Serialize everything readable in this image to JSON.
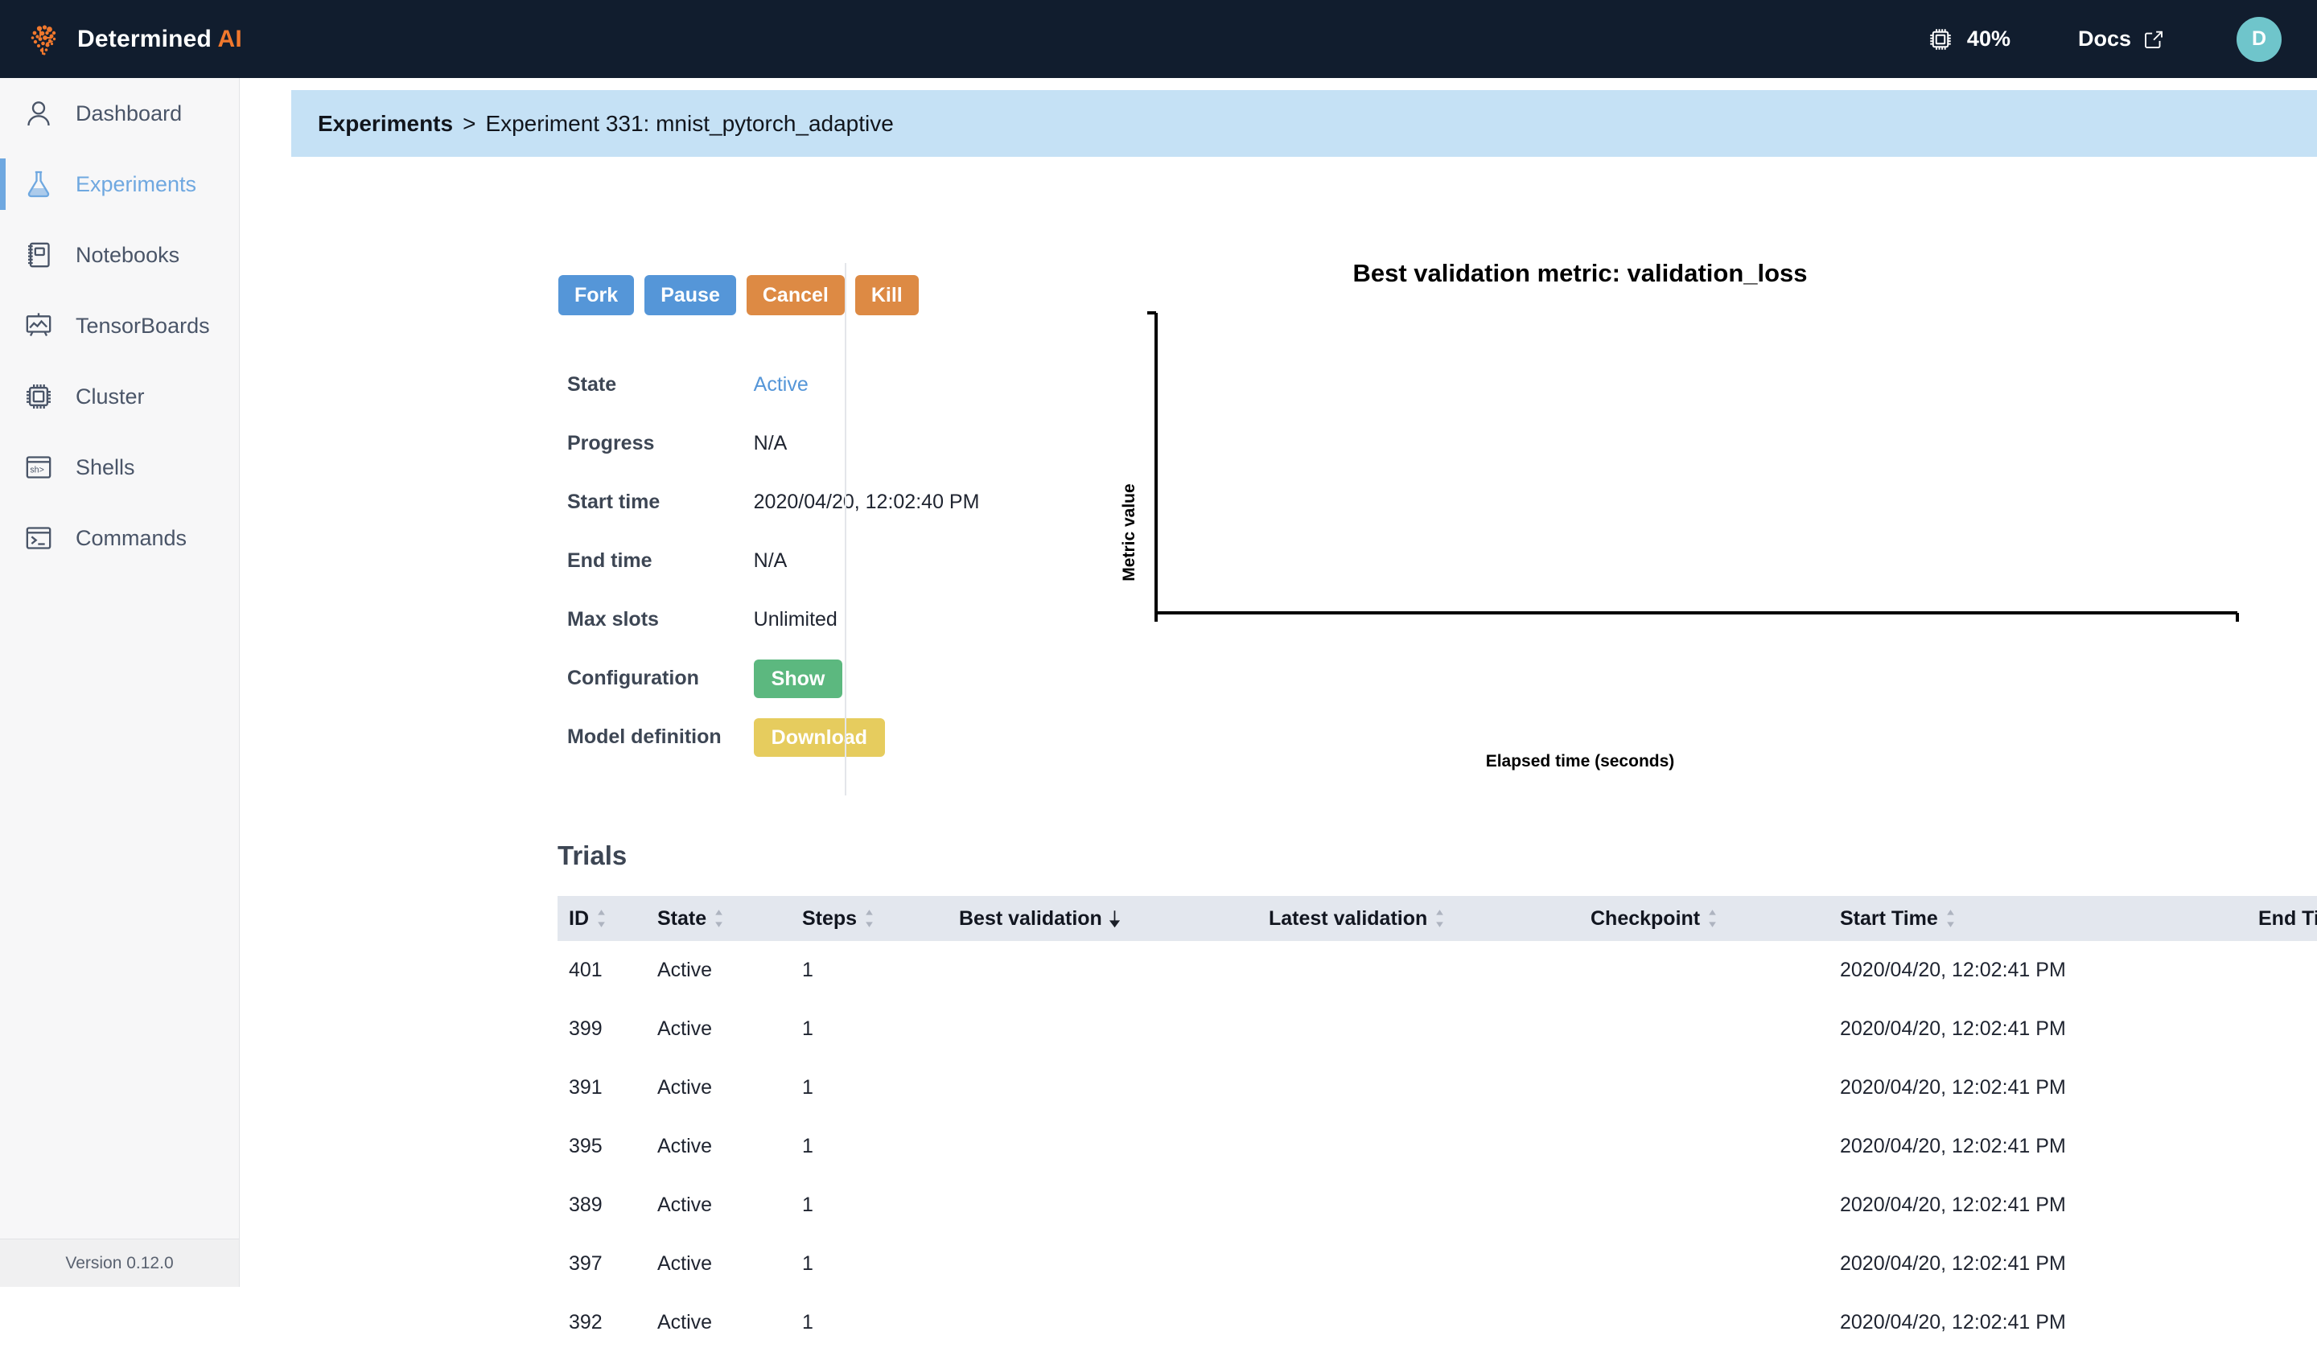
{
  "topbar": {
    "brand_name": "Determined",
    "brand_suffix": "AI",
    "brand_logo_icon": "brain-logo-icon",
    "cluster_icon": "cpu-chip-icon",
    "cluster_utilization": "40%",
    "docs_label": "Docs",
    "docs_icon": "external-link-icon",
    "avatar_initial": "D"
  },
  "sidebar": {
    "items": [
      {
        "label": "Dashboard",
        "icon": "user-icon",
        "active": false
      },
      {
        "label": "Experiments",
        "icon": "flask-icon",
        "active": true
      },
      {
        "label": "Notebooks",
        "icon": "notebook-icon",
        "active": false
      },
      {
        "label": "TensorBoards",
        "icon": "chart-board-icon",
        "active": false
      },
      {
        "label": "Cluster",
        "icon": "cpu-chip-icon",
        "active": false
      },
      {
        "label": "Shells",
        "icon": "shell-prompt-icon",
        "active": false
      },
      {
        "label": "Commands",
        "icon": "terminal-icon",
        "active": false
      }
    ],
    "version": "Version 0.12.0"
  },
  "breadcrumb": {
    "root": "Experiments",
    "separator": ">",
    "current": "Experiment 331: mnist_pytorch_adaptive"
  },
  "actions": [
    {
      "label": "Fork",
      "style": "blue"
    },
    {
      "label": "Pause",
      "style": "blue"
    },
    {
      "label": "Cancel",
      "style": "orange"
    },
    {
      "label": "Kill",
      "style": "orange"
    }
  ],
  "details": {
    "state_label": "State",
    "state_value": "Active",
    "progress_label": "Progress",
    "progress_value": "N/A",
    "start_time_label": "Start time",
    "start_time_value": "2020/04/20, 12:02:40 PM",
    "end_time_label": "End time",
    "end_time_value": "N/A",
    "max_slots_label": "Max slots",
    "max_slots_value": "Unlimited",
    "configuration_label": "Configuration",
    "configuration_button": "Show",
    "model_definition_label": "Model definition",
    "model_definition_button": "Download"
  },
  "chart_data": {
    "type": "line",
    "title": "Best validation metric: validation_loss",
    "xlabel": "Elapsed time (seconds)",
    "ylabel": "Metric value",
    "series": [],
    "x": [],
    "values": [],
    "xticks": [],
    "yticks": [],
    "grid": false,
    "legend": false,
    "note": "Empty plot — axes drawn with no data points rendered"
  },
  "trials": {
    "section_title": "Trials",
    "columns": [
      {
        "label": "ID",
        "sort": "none"
      },
      {
        "label": "State",
        "sort": "none"
      },
      {
        "label": "Steps",
        "sort": "none"
      },
      {
        "label": "Best validation",
        "sort": "desc"
      },
      {
        "label": "Latest validation",
        "sort": "none"
      },
      {
        "label": "Checkpoint",
        "sort": "none"
      },
      {
        "label": "Start Time",
        "sort": "none"
      },
      {
        "label": "End Time",
        "sort": "none"
      }
    ],
    "rows": [
      {
        "id": "401",
        "state": "Active",
        "steps": "1",
        "best_validation": "",
        "latest_validation": "",
        "checkpoint": "",
        "start_time": "2020/04/20, 12:02:41 PM",
        "end_time": ""
      },
      {
        "id": "399",
        "state": "Active",
        "steps": "1",
        "best_validation": "",
        "latest_validation": "",
        "checkpoint": "",
        "start_time": "2020/04/20, 12:02:41 PM",
        "end_time": ""
      },
      {
        "id": "391",
        "state": "Active",
        "steps": "1",
        "best_validation": "",
        "latest_validation": "",
        "checkpoint": "",
        "start_time": "2020/04/20, 12:02:41 PM",
        "end_time": ""
      },
      {
        "id": "395",
        "state": "Active",
        "steps": "1",
        "best_validation": "",
        "latest_validation": "",
        "checkpoint": "",
        "start_time": "2020/04/20, 12:02:41 PM",
        "end_time": ""
      },
      {
        "id": "389",
        "state": "Active",
        "steps": "1",
        "best_validation": "",
        "latest_validation": "",
        "checkpoint": "",
        "start_time": "2020/04/20, 12:02:41 PM",
        "end_time": ""
      },
      {
        "id": "397",
        "state": "Active",
        "steps": "1",
        "best_validation": "",
        "latest_validation": "",
        "checkpoint": "",
        "start_time": "2020/04/20, 12:02:41 PM",
        "end_time": ""
      },
      {
        "id": "392",
        "state": "Active",
        "steps": "1",
        "best_validation": "",
        "latest_validation": "",
        "checkpoint": "",
        "start_time": "2020/04/20, 12:02:41 PM",
        "end_time": ""
      }
    ]
  },
  "colors": {
    "topbar_bg": "#111d2e",
    "brand_accent": "#f0782d",
    "breadcrumb_bg": "#c5e1f5",
    "nav_active": "#6fa8e0",
    "button_blue": "#5596d8",
    "button_orange": "#dd8a44",
    "button_green": "#5cb87f",
    "button_yellow": "#e6cc5e",
    "avatar_bg": "#6fc5cb",
    "table_header_bg": "#e3e7ee"
  }
}
